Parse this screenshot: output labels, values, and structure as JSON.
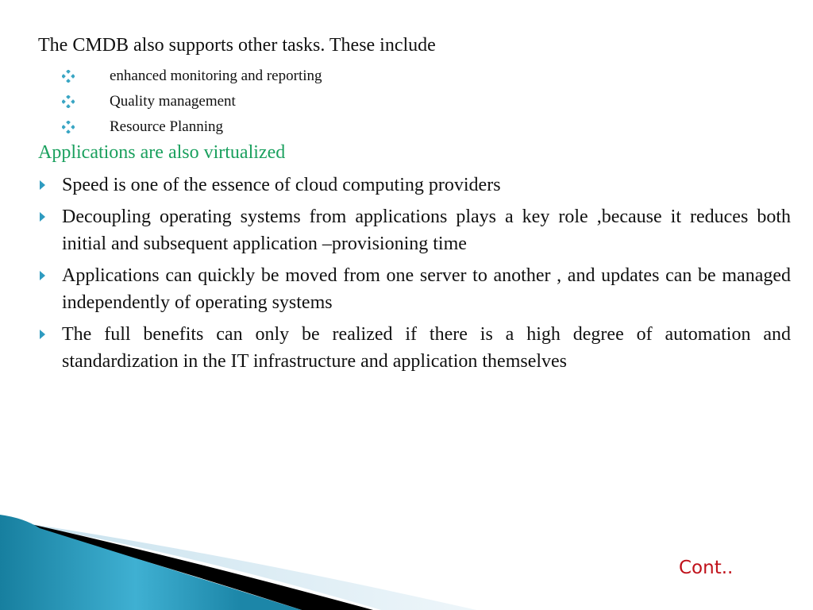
{
  "slide": {
    "intro": "The CMDB also supports other tasks. These include",
    "sub_items": [
      {
        "label": "enhanced monitoring and reporting",
        "icon": "diamond-bullet-icon"
      },
      {
        "label": "Quality management",
        "icon": "diamond-bullet-icon"
      },
      {
        "label": "Resource Planning",
        "icon": "diamond-bullet-icon"
      }
    ],
    "green_heading": "Applications are also virtualized",
    "bullets": [
      {
        "text": "Speed is one of the essence of cloud computing providers",
        "icon": "triangle-bullet-icon"
      },
      {
        "text": "Decoupling operating systems from applications plays a key role ,because it reduces both initial and subsequent application –provisioning time",
        "icon": "triangle-bullet-icon"
      },
      {
        "text": "Applications can quickly be moved from one server to another , and updates can be managed independently of operating systems",
        "icon": "triangle-bullet-icon"
      },
      {
        "text": "The full benefits can only be realized if there is a high degree of automation and standardization in the IT infrastructure and application themselves",
        "icon": "triangle-bullet-icon"
      }
    ],
    "footer_link": "Cont..",
    "colors": {
      "heading_green": "#1aa05e",
      "bullet_blue": "#2e9bc0",
      "cont_red": "#c0111a",
      "swoosh_teal": "#1f8fb0"
    }
  }
}
